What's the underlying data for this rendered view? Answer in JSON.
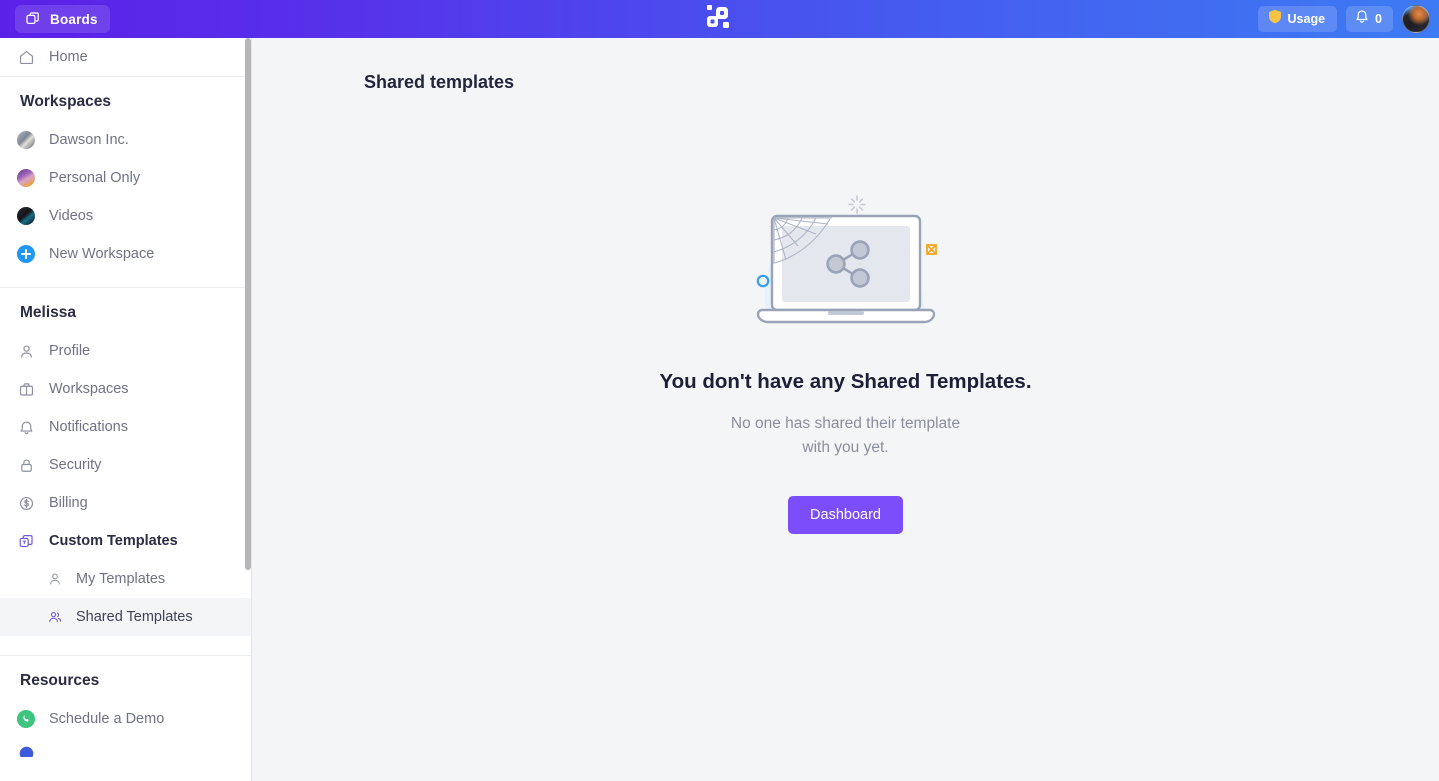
{
  "topbar": {
    "boards_label": "Boards",
    "boards_icon": "copy-stack-icon",
    "logo_icon": "app-logo-icon",
    "usage_label": "Usage",
    "usage_icon": "shield-icon",
    "notification_icon": "bell-icon",
    "notification_count": "0",
    "avatar_icon": "user-avatar",
    "gradient_from": "#5b21e8",
    "gradient_to": "#3d7bf3"
  },
  "sidebar": {
    "home": {
      "label": "Home",
      "icon": "home-icon"
    },
    "workspaces_heading": "Workspaces",
    "workspaces": [
      {
        "label": "Dawson Inc.",
        "icon": "workspace-avatar"
      },
      {
        "label": "Personal Only",
        "icon": "workspace-avatar"
      },
      {
        "label": "Videos",
        "icon": "workspace-avatar"
      },
      {
        "label": "New Workspace",
        "icon": "plus-circle-icon"
      }
    ],
    "account_heading": "Melissa",
    "account_items": [
      {
        "label": "Profile",
        "icon": "user-icon"
      },
      {
        "label": "Workspaces",
        "icon": "briefcase-icon"
      },
      {
        "label": "Notifications",
        "icon": "bell-icon"
      },
      {
        "label": "Security",
        "icon": "lock-icon"
      },
      {
        "label": "Billing",
        "icon": "dollar-circle-icon"
      },
      {
        "label": "Custom Templates",
        "icon": "template-stack-icon"
      }
    ],
    "template_subitems": [
      {
        "label": "My Templates",
        "icon": "user-icon",
        "active": false
      },
      {
        "label": "Shared Templates",
        "icon": "users-icon",
        "active": true
      }
    ],
    "resources_heading": "Resources",
    "resources": [
      {
        "label": "Schedule a Demo",
        "icon": "phone-circle-icon"
      }
    ],
    "active_color": "#6b4ee6"
  },
  "main": {
    "page_title": "Shared templates",
    "illustration_icon": "laptop-share-empty-illustration",
    "empty_title": "You don't have any Shared Templates.",
    "empty_subtitle_line1": "No one has shared their template",
    "empty_subtitle_line2": "with you yet.",
    "dashboard_button": "Dashboard",
    "button_color": "#7c4dfa",
    "background": "#f4f5f7"
  }
}
